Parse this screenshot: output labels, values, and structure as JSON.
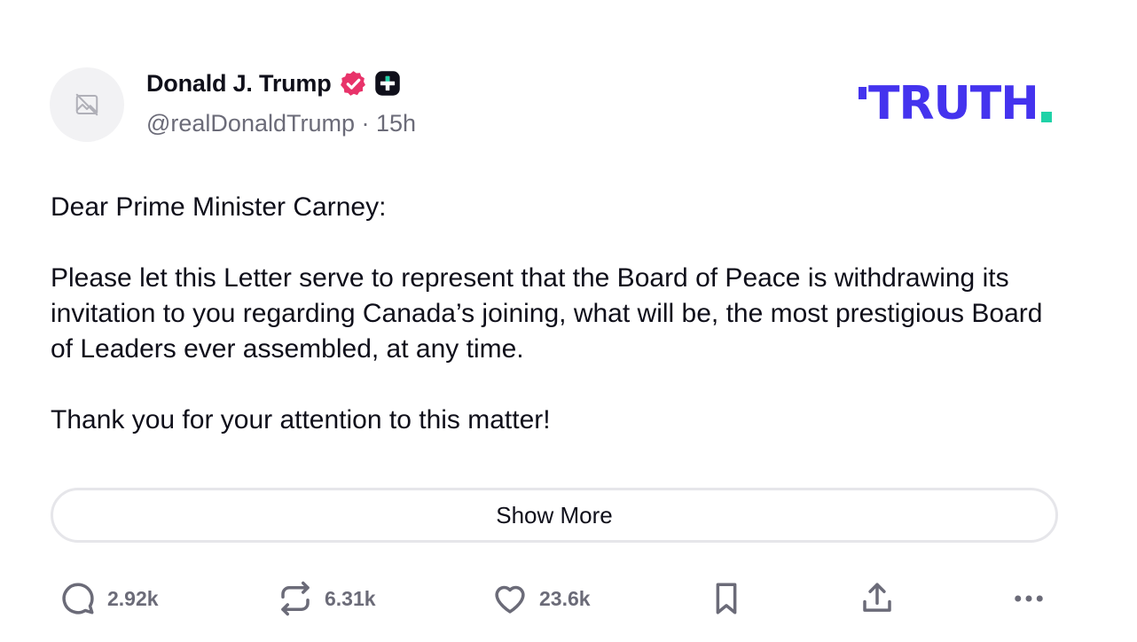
{
  "author": {
    "display_name": "Donald J. Trump",
    "handle": "@realDonaldTrump",
    "separator": " · ",
    "time_ago": "15h"
  },
  "brand": {
    "logo_text": "TRUTH",
    "primary_color": "#4433ee",
    "accent_color": "#1fd2a7"
  },
  "post": {
    "paragraphs": [
      "Dear Prime Minister Carney:",
      "Please let this Letter serve to represent that the Board of Peace is withdrawing its invitation to you regarding Canada’s joining, what will be, the most prestigious Board of Leaders ever assembled, at any time.",
      "Thank you for your attention to this matter!"
    ],
    "show_more_label": "Show More"
  },
  "actions": {
    "replies": "2.92k",
    "retruths": "6.31k",
    "likes": "23.6k"
  },
  "icons": {
    "avatar": "image-placeholder-icon",
    "verified": "verified-badge-icon",
    "plus": "plus-badge-icon",
    "reply": "comment-icon",
    "retruth": "repost-icon",
    "like": "heart-icon",
    "bookmark": "bookmark-icon",
    "share": "share-icon",
    "more": "more-icon"
  },
  "colors": {
    "verified_badge": "#e8336a",
    "muted_text": "#6b6b78"
  }
}
